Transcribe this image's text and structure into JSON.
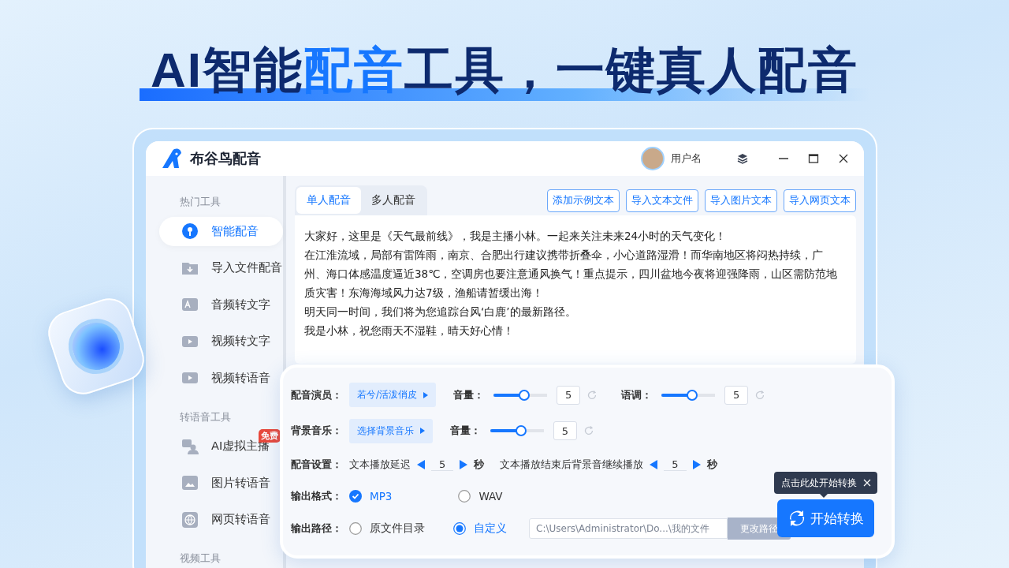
{
  "headline": [
    {
      "text": "AI智能",
      "highlight": false
    },
    {
      "text": "配音",
      "highlight": true
    },
    {
      "text": "工具，一键真人配音",
      "highlight": false
    }
  ],
  "app": {
    "name": "布谷鸟配音",
    "user": "用户名"
  },
  "sidebar": [
    {
      "kind": "section",
      "label": "热门工具"
    },
    {
      "kind": "item",
      "label": "智能配音",
      "selected": true
    },
    {
      "kind": "item",
      "label": "导入文件配音",
      "selected": false
    },
    {
      "kind": "item",
      "label": "音频转文字",
      "selected": false
    },
    {
      "kind": "item",
      "label": "视频转文字",
      "selected": false
    },
    {
      "kind": "item",
      "label": "视频转语音",
      "selected": false
    },
    {
      "kind": "section",
      "label": "转语音工具"
    },
    {
      "kind": "item",
      "label": "AI虚拟主播",
      "selected": false,
      "badge": "免费"
    },
    {
      "kind": "item",
      "label": "图片转语音",
      "selected": false
    },
    {
      "kind": "item",
      "label": "网页转语音",
      "selected": false
    },
    {
      "kind": "section",
      "label": "视频工具"
    }
  ],
  "tabs": [
    {
      "label": "单人配音",
      "selected": true
    },
    {
      "label": "多人配音",
      "selected": false
    }
  ],
  "actions": [
    "添加示例文本",
    "导入文本文件",
    "导入图片文本",
    "导入网页文本"
  ],
  "script": [
    "大家好，这里是《天气最前线》，我是主播小林。一起来关注未来24小时的天气变化！",
    "在江淮流域，局部有雷阵雨，南京、合肥出行建议携带折叠伞，小心道路湿滑！而华南地区将闷热持续，广州、海口体感温度逼近38℃，空调房也要注意通风换气！重点提示，四川盆地今夜将迎强降雨，山区需防范地质灾害！东海海域风力达7级，渔船请暂缓出海！",
    "明天同一时间，我们将为您追踪台风‘白鹿’的最新路径。",
    "我是小林，祝您雨天不湿鞋，晴天好心情！"
  ],
  "settings": {
    "actor": {
      "label": "配音演员：",
      "choice": "若兮/活泼俏皮",
      "sliders": [
        {
          "label": "音量：",
          "level": 0.57,
          "value": "5"
        },
        {
          "label": "语调：",
          "level": 0.57,
          "value": "5"
        }
      ]
    },
    "music": {
      "label": "背景音乐：",
      "choice": "选择背景音乐",
      "sliders": [
        {
          "label": "音量：",
          "level": 0.57,
          "value": "5"
        }
      ]
    },
    "timing": {
      "label": "配音设置：",
      "steppers": [
        {
          "label": "文本播放延迟",
          "value": "5",
          "unit": "秒"
        },
        {
          "label": "文本播放结束后背景音继续播放",
          "value": "5",
          "unit": "秒"
        }
      ]
    },
    "format": {
      "label": "输出格式：",
      "options": [
        {
          "label": "MP3",
          "selected": true
        },
        {
          "label": "WAV",
          "selected": false
        }
      ]
    },
    "path": {
      "label": "输出路径：",
      "options": [
        {
          "label": "原文件目录",
          "selected": false
        },
        {
          "label": "自定义",
          "selected": true
        }
      ],
      "value": "C:\\Users\\Administrator\\Do...\\我的文件",
      "button": "更改路径"
    }
  },
  "start": {
    "label": "开始转换",
    "tooltip": "点击此处开始转换"
  }
}
